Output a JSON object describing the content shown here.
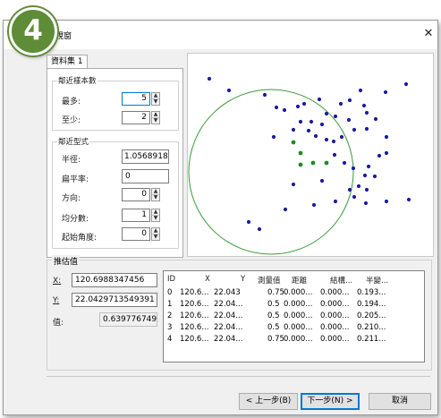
{
  "step_badge": "4",
  "window": {
    "title": "視窗",
    "close_glyph": "✕"
  },
  "tab": {
    "label": "資料集 1"
  },
  "neighbors": {
    "group_label": "鄰近樣本數",
    "max_label": "最多:",
    "max_value": "5",
    "min_label": "至少:",
    "min_value": "2"
  },
  "neighborhood": {
    "group_label": "鄰近型式",
    "radius_label": "半徑:",
    "radius_value": "1.05689187",
    "flatten_label": "扁平率:",
    "flatten_value": "0",
    "direction_label": "方向:",
    "direction_value": "0",
    "sectors_label": "均分數:",
    "sectors_value": "1",
    "start_angle_label": "起始角度:",
    "start_angle_value": "0"
  },
  "prediction": {
    "group_label": "推估值",
    "x_label": "X:",
    "x_value": "120.6988347456",
    "y_label": "Y:",
    "y_value": "22.0429713549391",
    "value_label": "值:",
    "value_value": "0.6397767490"
  },
  "table": {
    "headers": [
      "ID",
      "X",
      "Y",
      "測量值",
      "距離",
      "結構...",
      "半變..."
    ],
    "rows": [
      [
        "0",
        "120.6...",
        "22.043",
        "0.75",
        "0.000...",
        "0.000...",
        "0.193..."
      ],
      [
        "1",
        "120.6...",
        "22.04...",
        "0.5",
        "0.000...",
        "0.000...",
        "0.194..."
      ],
      [
        "2",
        "120.6...",
        "22.04...",
        "0.5",
        "0.000...",
        "0.000...",
        "0.205..."
      ],
      [
        "3",
        "120.6...",
        "22.04...",
        "0.5",
        "0.000...",
        "0.000...",
        "0.210..."
      ],
      [
        "4",
        "120.6...",
        "22.04...",
        "0.75",
        "0.000...",
        "0.000...",
        "0.211..."
      ]
    ]
  },
  "buttons": {
    "back": "< 上一步(B)",
    "next": "下一步(N) >",
    "cancel": "取消"
  },
  "plot_colors": {
    "point": "#1c1ca0",
    "selected": "#1e8c1e",
    "circle": "#3c9a3c"
  }
}
